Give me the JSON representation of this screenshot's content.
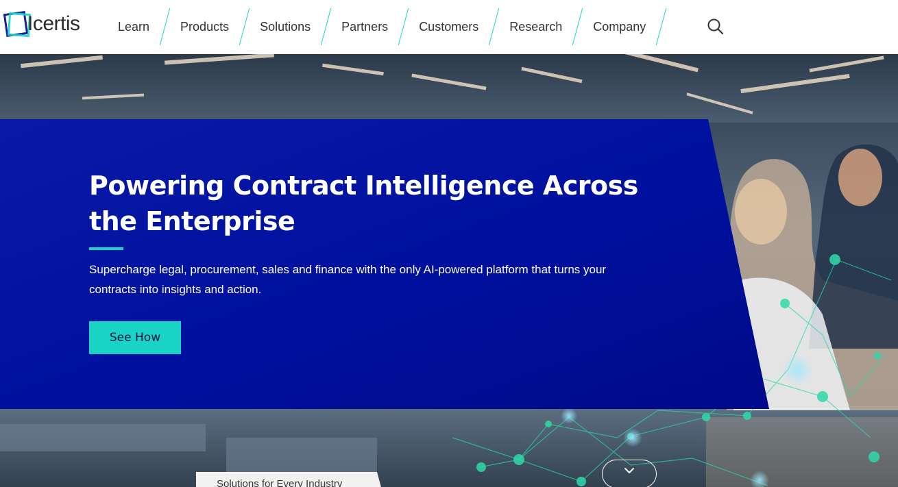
{
  "brand": {
    "name": "Icertis",
    "accent": "#19d3c5",
    "primary_blue": "#0011a0"
  },
  "nav": {
    "items": [
      {
        "label": "Learn"
      },
      {
        "label": "Products"
      },
      {
        "label": "Solutions"
      },
      {
        "label": "Partners"
      },
      {
        "label": "Customers"
      },
      {
        "label": "Research"
      },
      {
        "label": "Company"
      }
    ],
    "search_icon": "search-icon"
  },
  "hero": {
    "title": "Powering Contract Intelligence Across the Enterprise",
    "subtitle": "Supercharge legal, procurement, sales and finance with the only AI-powered platform that turns your contracts into insights and action.",
    "cta_label": "See How",
    "scroll_icon": "chevron-down-icon",
    "industry_tab_label": "Solutions for Every Industry"
  }
}
